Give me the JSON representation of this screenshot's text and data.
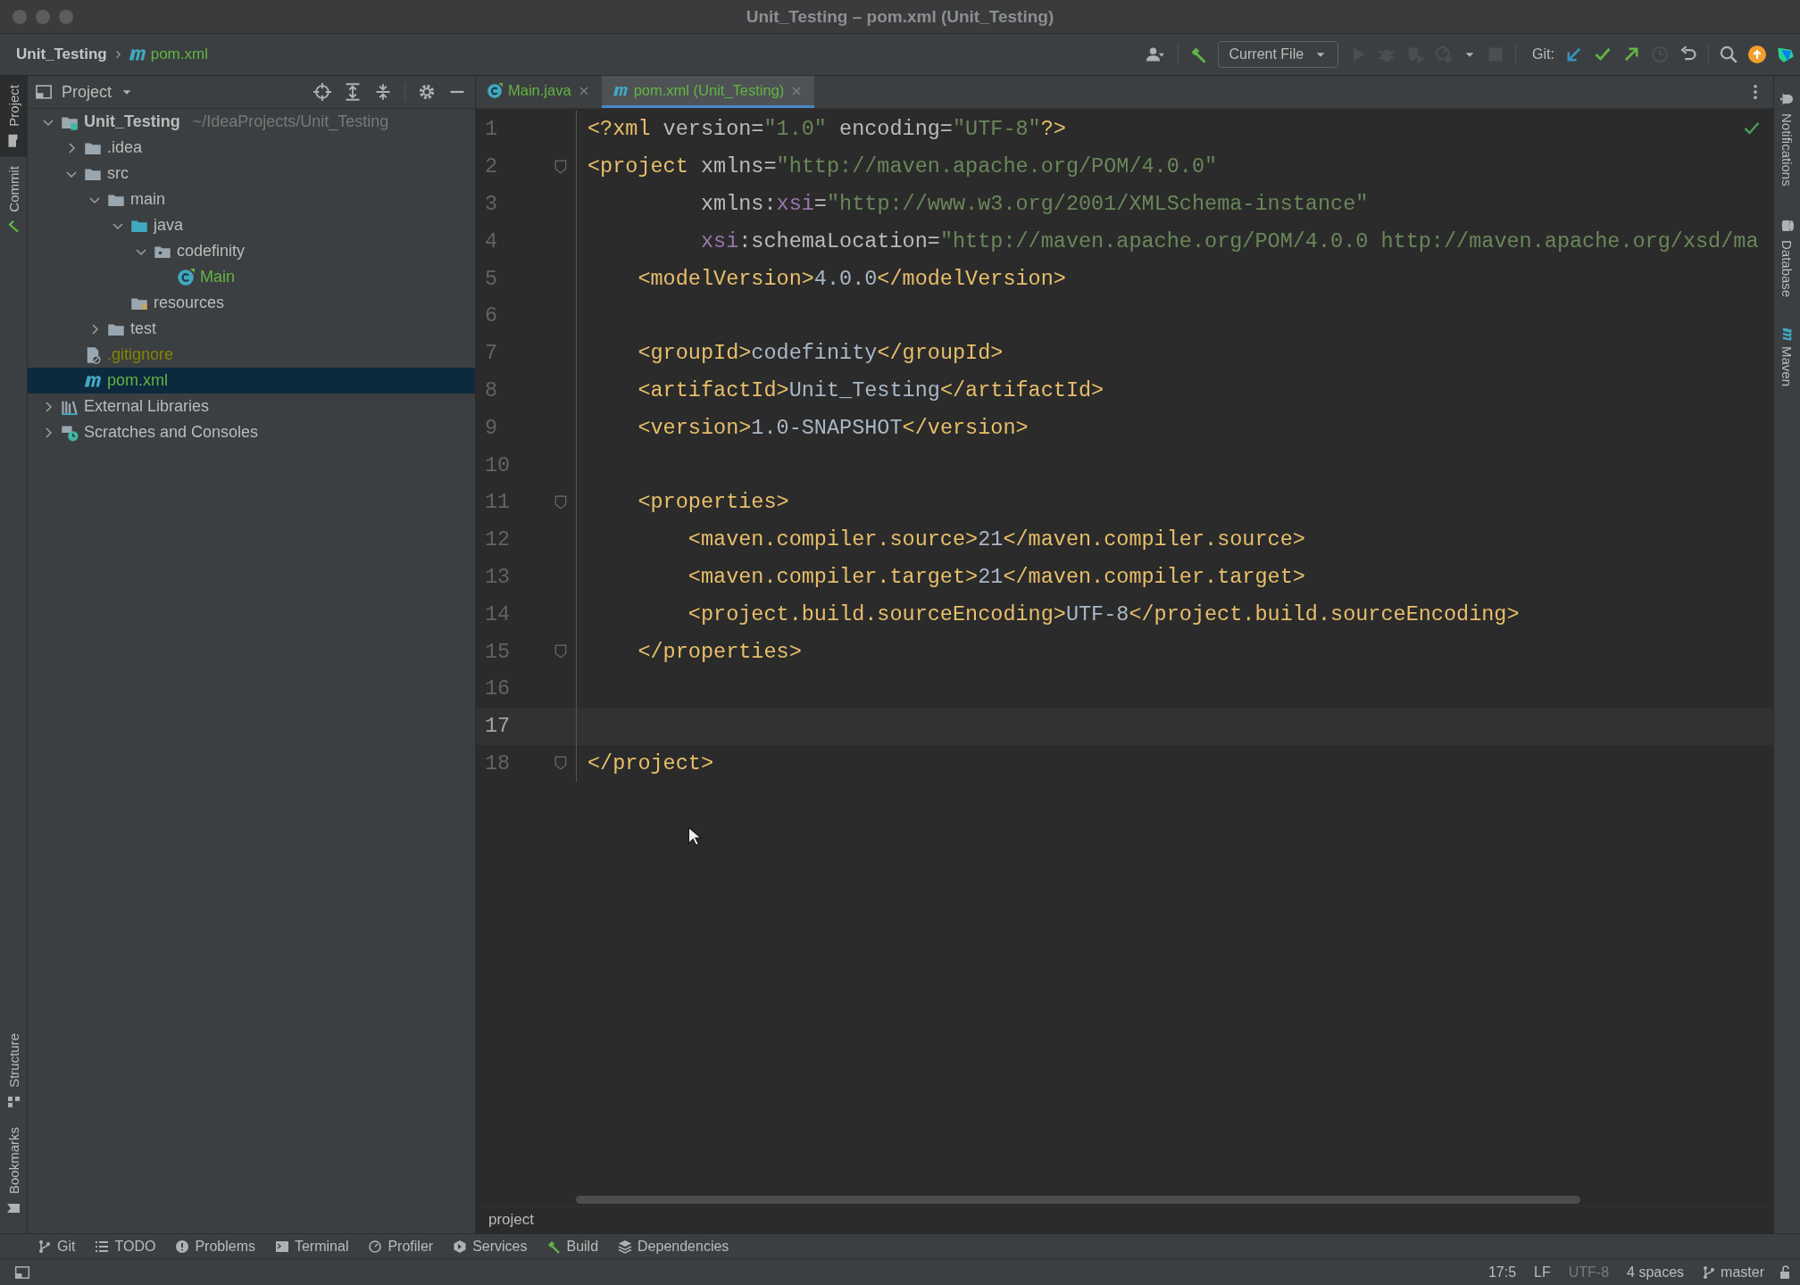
{
  "window": {
    "title": "Unit_Testing – pom.xml (Unit_Testing)"
  },
  "navigation": [
    {
      "kind": "project",
      "label": "Unit_Testing"
    },
    {
      "kind": "maven",
      "label": "pom.xml"
    }
  ],
  "toolbar": [
    {
      "kind": "user",
      "disabled": false
    },
    {
      "kind": "build",
      "disabled": false
    },
    {
      "kind": "config",
      "label": "Current File",
      "disabled": false
    },
    {
      "kind": "run",
      "disabled": true
    },
    {
      "kind": "debug",
      "disabled": true
    },
    {
      "kind": "coverage",
      "disabled": true
    },
    {
      "kind": "profile",
      "disabled": true
    },
    {
      "kind": "stop",
      "disabled": true
    },
    {
      "kind": "git-label",
      "label": "Git:"
    },
    {
      "kind": "update",
      "disabled": false
    },
    {
      "kind": "commit",
      "disabled": false
    },
    {
      "kind": "push",
      "disabled": false
    },
    {
      "kind": "history",
      "disabled": true
    },
    {
      "kind": "rollback",
      "disabled": false
    },
    {
      "kind": "search",
      "disabled": false
    },
    {
      "kind": "ide-update",
      "disabled": false
    },
    {
      "kind": "toolbox",
      "disabled": false
    }
  ],
  "left_strip": {
    "top": [
      {
        "kind": "project",
        "label": "Project",
        "selected": true
      },
      {
        "kind": "commit",
        "label": "Commit",
        "selected": false
      }
    ],
    "bottom": [
      {
        "kind": "structure",
        "label": "Structure",
        "selected": false
      },
      {
        "kind": "bookmarks",
        "label": "Bookmarks",
        "selected": false
      }
    ]
  },
  "project_panel": {
    "title": "Project",
    "tree": [
      {
        "kind": "module",
        "label": "Unit_Testing",
        "hint": "~/IdeaProjects/Unit_Testing",
        "expanded": true,
        "selected": false,
        "color": "#bbbbbb",
        "children": [
          {
            "kind": "folder",
            "label": ".idea",
            "expanded": false,
            "selected": false,
            "color": "#bbbbbb"
          },
          {
            "kind": "folder",
            "label": "src",
            "expanded": true,
            "selected": false,
            "color": "#bbbbbb",
            "children": [
              {
                "kind": "folder",
                "label": "main",
                "expanded": true,
                "selected": false,
                "color": "#bbbbbb",
                "children": [
                  {
                    "kind": "srcfolder",
                    "label": "java",
                    "expanded": true,
                    "selected": false,
                    "color": "#bbbbbb",
                    "children": [
                      {
                        "kind": "package",
                        "label": "codefinity",
                        "expanded": true,
                        "selected": false,
                        "color": "#bbbbbb",
                        "children": [
                          {
                            "kind": "class",
                            "label": "Main",
                            "selected": false,
                            "color": "#62b543"
                          }
                        ]
                      }
                    ]
                  },
                  {
                    "kind": "resfolder",
                    "label": "resources",
                    "selected": false,
                    "color": "#bbbbbb"
                  }
                ]
              },
              {
                "kind": "folder",
                "label": "test",
                "expanded": false,
                "selected": false,
                "color": "#bbbbbb"
              }
            ]
          },
          {
            "kind": "gitignore",
            "label": ".gitignore",
            "selected": false,
            "color": "#848504"
          },
          {
            "kind": "maven",
            "label": "pom.xml",
            "selected": true,
            "color": "#62b543"
          }
        ]
      },
      {
        "kind": "libs",
        "label": "External Libraries",
        "expanded": false,
        "selected": false,
        "color": "#bbbbbb"
      },
      {
        "kind": "scratch",
        "label": "Scratches and Consoles",
        "expanded": false,
        "selected": false,
        "color": "#bbbbbb"
      }
    ]
  },
  "editor": {
    "tabs": [
      {
        "kind": "class",
        "label": "Main.java",
        "selected": false,
        "color": "#62b543"
      },
      {
        "kind": "maven",
        "label": "pom.xml (Unit_Testing)",
        "selected": true,
        "color": "#62b543"
      }
    ],
    "lines": [
      {
        "number": "1",
        "current": false,
        "fold": false,
        "tokens": [
          {
            "kind": "tag",
            "t": "<?xml"
          },
          {
            "kind": "attr",
            "t": " version="
          },
          {
            "kind": "value",
            "t": "\"1.0\""
          },
          {
            "kind": "attr",
            "t": " encoding="
          },
          {
            "kind": "value",
            "t": "\"UTF-8\""
          },
          {
            "kind": "tag",
            "t": "?>"
          }
        ]
      },
      {
        "number": "2",
        "current": false,
        "fold": true,
        "tokens": [
          {
            "kind": "tag",
            "t": "<project"
          },
          {
            "kind": "attr",
            "t": " xmlns="
          },
          {
            "kind": "value",
            "t": "\"http://maven.apache.org/POM/4.0.0\""
          }
        ]
      },
      {
        "number": "3",
        "current": false,
        "fold": false,
        "tokens": [
          {
            "kind": "attr",
            "t": "         xmlns:"
          },
          {
            "kind": "ns",
            "t": "xsi"
          },
          {
            "kind": "attr",
            "t": "="
          },
          {
            "kind": "value",
            "t": "\"http://www.w3.org/2001/XMLSchema-instance\""
          }
        ]
      },
      {
        "number": "4",
        "current": false,
        "fold": false,
        "tokens": [
          {
            "kind": "ns",
            "t": "         xsi"
          },
          {
            "kind": "attr",
            "t": ":schemaLocation="
          },
          {
            "kind": "value",
            "t": "\"http://maven.apache.org/POM/4.0.0 http://maven.apache.org/xsd/ma"
          }
        ]
      },
      {
        "number": "5",
        "current": false,
        "fold": false,
        "tokens": [
          {
            "kind": "tag",
            "t": "    <modelVersion>"
          },
          {
            "kind": "text",
            "t": "4.0.0"
          },
          {
            "kind": "tag",
            "t": "</modelVersion>"
          }
        ]
      },
      {
        "number": "6",
        "current": false,
        "fold": false
      },
      {
        "number": "7",
        "current": false,
        "fold": false,
        "tokens": [
          {
            "kind": "tag",
            "t": "    <groupId>"
          },
          {
            "kind": "text",
            "t": "codefinity"
          },
          {
            "kind": "tag",
            "t": "</groupId>"
          }
        ]
      },
      {
        "number": "8",
        "current": false,
        "fold": false,
        "tokens": [
          {
            "kind": "tag",
            "t": "    <artifactId>"
          },
          {
            "kind": "text",
            "t": "Unit_Testing"
          },
          {
            "kind": "tag",
            "t": "</artifactId>"
          }
        ]
      },
      {
        "number": "9",
        "current": false,
        "fold": false,
        "tokens": [
          {
            "kind": "tag",
            "t": "    <version>"
          },
          {
            "kind": "text",
            "t": "1.0-SNAPSHOT"
          },
          {
            "kind": "tag",
            "t": "</version>"
          }
        ]
      },
      {
        "number": "10",
        "current": false,
        "fold": false
      },
      {
        "number": "11",
        "current": false,
        "fold": true,
        "tokens": [
          {
            "kind": "tag",
            "t": "    <properties>"
          }
        ]
      },
      {
        "number": "12",
        "current": false,
        "fold": false,
        "tokens": [
          {
            "kind": "tag",
            "t": "        <maven.compiler.source>"
          },
          {
            "kind": "text",
            "t": "21"
          },
          {
            "kind": "tag",
            "t": "</maven.compiler.source>"
          }
        ]
      },
      {
        "number": "13",
        "current": false,
        "fold": false,
        "tokens": [
          {
            "kind": "tag",
            "t": "        <maven.compiler.target>"
          },
          {
            "kind": "text",
            "t": "21"
          },
          {
            "kind": "tag",
            "t": "</maven.compiler.target>"
          }
        ]
      },
      {
        "number": "14",
        "current": false,
        "fold": false,
        "tokens": [
          {
            "kind": "tag",
            "t": "        <project.build.sourceEncoding>"
          },
          {
            "kind": "text",
            "t": "UTF-8"
          },
          {
            "kind": "tag",
            "t": "</project.build.sourceEncoding>"
          }
        ]
      },
      {
        "number": "15",
        "current": false,
        "fold": true,
        "tokens": [
          {
            "kind": "tag",
            "t": "    </properties>"
          }
        ]
      },
      {
        "number": "16",
        "current": false,
        "fold": false
      },
      {
        "number": "17",
        "current": true,
        "fold": false
      },
      {
        "number": "18",
        "current": false,
        "fold": true,
        "tokens": [
          {
            "kind": "tag",
            "t": "</project>"
          }
        ]
      }
    ],
    "breadcrumb": "project"
  },
  "right_strip": [
    {
      "kind": "notifications",
      "label": "Notifications"
    },
    {
      "kind": "database",
      "label": "Database"
    },
    {
      "kind": "maven",
      "label": "Maven"
    }
  ],
  "tool_windows": [
    {
      "kind": "git",
      "label": "Git"
    },
    {
      "kind": "todo",
      "label": "TODO"
    },
    {
      "kind": "problems",
      "label": "Problems"
    },
    {
      "kind": "terminal",
      "label": "Terminal"
    },
    {
      "kind": "profiler",
      "label": "Profiler"
    },
    {
      "kind": "services",
      "label": "Services"
    },
    {
      "kind": "build",
      "label": "Build"
    },
    {
      "kind": "dependencies",
      "label": "Dependencies"
    }
  ],
  "status_bar": [
    {
      "kind": "position",
      "text": "17:5"
    },
    {
      "kind": "plain",
      "text": "LF"
    },
    {
      "kind": "dim",
      "text": "UTF-8"
    },
    {
      "kind": "plain",
      "text": "4 spaces"
    },
    {
      "kind": "branch",
      "text": "master"
    }
  ]
}
